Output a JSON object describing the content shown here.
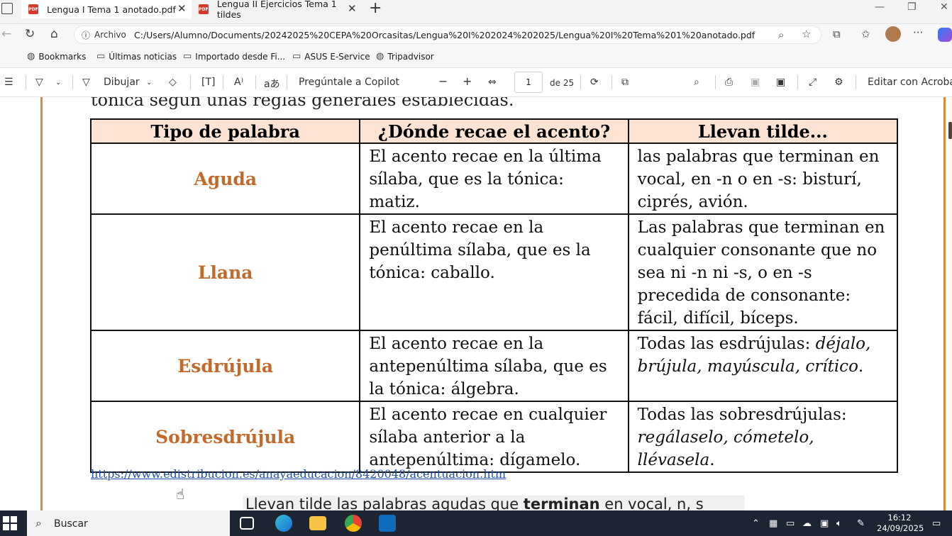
{
  "browser": {
    "tabs": [
      {
        "title": "Lengua I Tema 1 anotado.pdf",
        "active": true
      },
      {
        "title": "Lengua II Ejercicios Tema 1 tildes",
        "active": false
      }
    ],
    "new_tab_symbol": "+",
    "address": {
      "label": "Archivo",
      "url": "C:/Users/Alumno/Documents/20242025%20CEPA%20Orcasitas/Lengua%20I%202024%202025/Lengua%20I%20Tema%201%20anotado.pdf"
    },
    "bookmarks": [
      {
        "label": "Bookmarks",
        "icon": "globe-icon"
      },
      {
        "label": "Últimas noticias",
        "icon": "folder-icon"
      },
      {
        "label": "Importado desde Fi...",
        "icon": "folder-icon"
      },
      {
        "label": "ASUS E-Service",
        "icon": "folder-icon"
      },
      {
        "label": "Tripadvisor",
        "icon": "globe-icon"
      }
    ]
  },
  "pdf_toolbar": {
    "draw_label": "Dibujar",
    "copilot_label": "Pregúntale a Copilot",
    "page_current": "1",
    "page_total": "de 25",
    "edit_label": "Editar con Acrobat"
  },
  "document": {
    "clipped_text": "tónica según unas reglas generales establecidas.",
    "table": {
      "headers": [
        "Tipo de palabra",
        "¿Dónde recae el acento?",
        "Llevan tilde..."
      ],
      "rows": [
        {
          "type": "Aguda",
          "where": "El acento recae en la última sílaba, que es la tónica: matiz.",
          "tilde_plain": "las palabras que terminan en vocal, en -n o en -s: bisturí, ciprés, avión.",
          "tilde_italic": ""
        },
        {
          "type": "Llana",
          "where": "El acento recae en la penúltima sílaba, que es la tónica: caballo.",
          "tilde_plain": "Las palabras que terminan en cualquier consonante que no sea ni -n ni -s, o en -s precedida de consonante: fácil, difícil, bíceps.",
          "tilde_italic": ""
        },
        {
          "type": "Esdrújula",
          "where": "El acento recae en la antepenúltima sílaba, que es la tónica: álgebra.",
          "tilde_plain": "Todas las esdrújulas: ",
          "tilde_italic": "déjalo, brújula, mayúscula, crítico",
          "tilde_suffix": "."
        },
        {
          "type": "Sobresdrújula",
          "where": "El acento recae en cualquier sílaba anterior a la antepenúltima: dígamelo.",
          "tilde_plain": "Todas las sobresdrújulas: ",
          "tilde_italic": "regálaselo, cómetelo, llévasela",
          "tilde_suffix": "."
        }
      ]
    },
    "source_link": "https://www.edistribucion.es/anayaeducacion/8420048/acentuacion.htm",
    "next_text_before": "Llevan tilde las palabras agudas que ",
    "next_text_bold": "terminan",
    "next_text_after": " en vocal, n, s"
  },
  "taskbar": {
    "search_placeholder": "Buscar",
    "time": "16:12",
    "date": "24/09/2025"
  },
  "colors": {
    "header_bg": "#fde3d3",
    "type_color": "#c26a2a",
    "page_border": "#d98a3a",
    "link": "#1f4fa8"
  }
}
